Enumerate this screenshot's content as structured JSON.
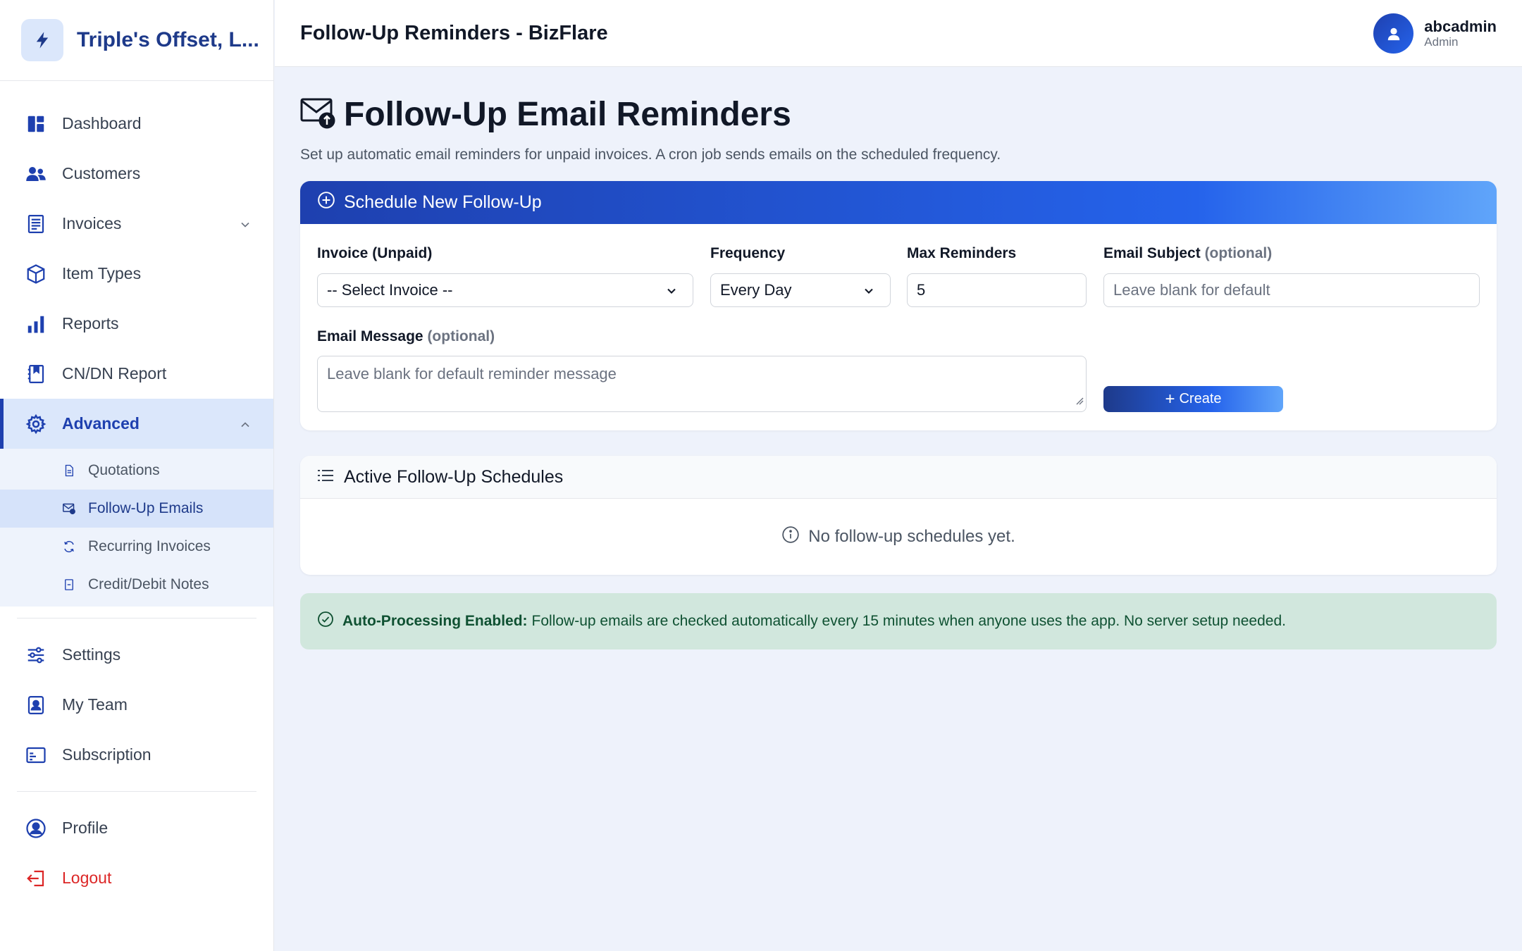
{
  "brand": {
    "name": "Triple's Offset, L..."
  },
  "topbar": {
    "title": "Follow-Up Reminders - BizFlare"
  },
  "user": {
    "name": "abcadmin",
    "role": "Admin"
  },
  "sidebar": {
    "items": [
      {
        "label": "Dashboard",
        "icon": "dashboard-icon"
      },
      {
        "label": "Customers",
        "icon": "users-icon"
      },
      {
        "label": "Invoices",
        "icon": "invoice-icon"
      },
      {
        "label": "Item Types",
        "icon": "box-icon"
      },
      {
        "label": "Reports",
        "icon": "bar-chart-icon"
      },
      {
        "label": "CN/DN Report",
        "icon": "book-icon"
      },
      {
        "label": "Advanced",
        "icon": "gear-icon"
      }
    ],
    "advanced_sub": [
      {
        "label": "Quotations",
        "icon": "document-icon"
      },
      {
        "label": "Follow-Up Emails",
        "icon": "envelope-icon"
      },
      {
        "label": "Recurring Invoices",
        "icon": "refresh-icon"
      },
      {
        "label": "Credit/Debit Notes",
        "icon": "note-icon"
      }
    ],
    "settings_items": [
      {
        "label": "Settings",
        "icon": "sliders-icon"
      },
      {
        "label": "My Team",
        "icon": "badge-icon"
      },
      {
        "label": "Subscription",
        "icon": "card-icon"
      }
    ],
    "account_items": [
      {
        "label": "Profile",
        "icon": "user-circle-icon"
      },
      {
        "label": "Logout",
        "icon": "logout-icon"
      }
    ]
  },
  "page": {
    "title": "Follow-Up Email Reminders",
    "subtitle": "Set up automatic email reminders for unpaid invoices. A cron job sends emails on the scheduled frequency."
  },
  "new_followup": {
    "heading": "Schedule New Follow-Up",
    "invoice_label": "Invoice (Unpaid)",
    "invoice_value": "-- Select Invoice --",
    "frequency_label": "Frequency",
    "frequency_value": "Every Day",
    "max_label": "Max Reminders",
    "max_value": "5",
    "subject_label": "Email Subject",
    "subject_optional": "(optional)",
    "subject_placeholder": "Leave blank for default",
    "message_label": "Email Message",
    "message_optional": "(optional)",
    "message_placeholder": "Leave blank for default reminder message",
    "create_label": "Create"
  },
  "active": {
    "heading": "Active Follow-Up Schedules",
    "empty_text": "No follow-up schedules yet."
  },
  "alert": {
    "bold": "Auto-Processing Enabled:",
    "text": "Follow-up emails are checked automatically every 15 minutes when anyone uses the app. No server setup needed."
  },
  "colors": {
    "accent": "#1e40af",
    "accent_light": "#dbe7fb",
    "success_bg": "#d1e7dd",
    "danger": "#dc2626"
  }
}
